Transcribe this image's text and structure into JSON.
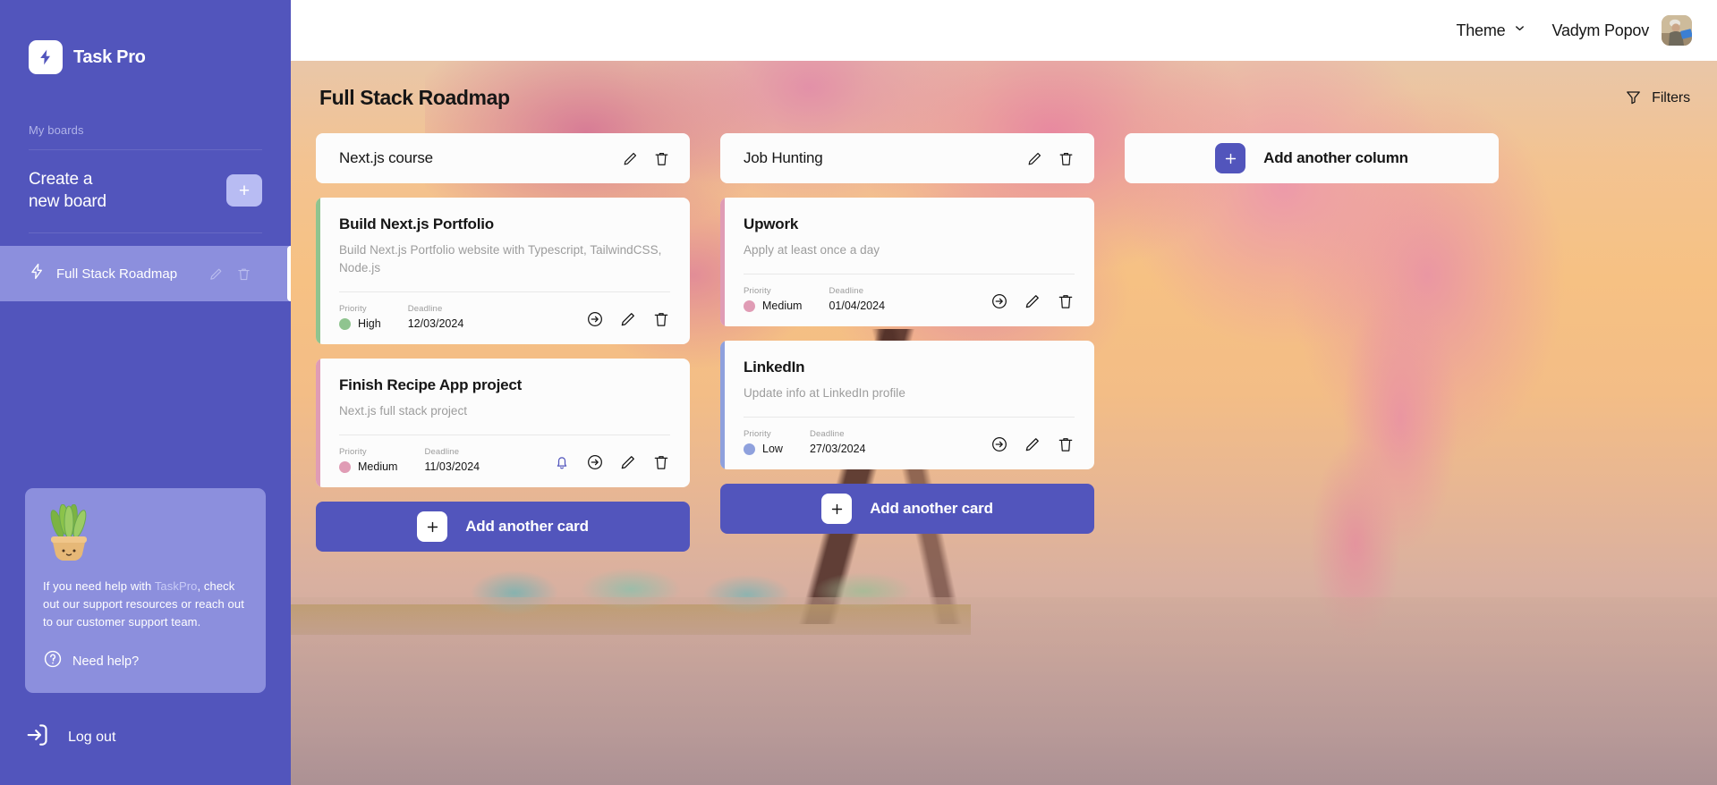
{
  "sidebar": {
    "brand": {
      "name": "Task Pro",
      "logo_icon": "lightning-bolt-icon"
    },
    "my_boards_label": "My boards",
    "create_board": {
      "text": "Create a\nnew board",
      "line1": "Create a",
      "line2": "new board",
      "plus_icon": "plus-icon"
    },
    "boards": [
      {
        "name": "Full Stack Roadmap",
        "icon": "lightning-bolt-icon",
        "active": true,
        "edit_icon": "pencil-icon",
        "delete_icon": "trash-icon"
      }
    ],
    "help": {
      "text_before": "If you need help with ",
      "highlight": "TaskPro",
      "text_after": ", check out our support resources or reach out to our customer support team.",
      "need_help_label": "Need help?",
      "need_help_icon": "question-circle-icon",
      "plant_icon": "potted-plant-icon"
    },
    "logout": {
      "label": "Log out",
      "icon": "logout-arrow-icon"
    }
  },
  "topbar": {
    "theme": {
      "label": "Theme",
      "chevron_icon": "chevron-down-icon"
    },
    "user": {
      "name": "Vadym Popov",
      "avatar_icon": "user-avatar"
    }
  },
  "board": {
    "title": "Full Stack Roadmap",
    "filters": {
      "label": "Filters",
      "icon": "funnel-icon"
    },
    "add_column": {
      "label": "Add another column",
      "plus_icon": "plus-icon"
    },
    "meta_labels": {
      "priority": "Priority",
      "deadline": "Deadline"
    },
    "columns": [
      {
        "title": "Next.js course",
        "edit_icon": "pencil-icon",
        "delete_icon": "trash-icon",
        "add_card_label": "Add another card",
        "cards": [
          {
            "title": "Build Next.js Portfolio",
            "description": "Build Next.js Portfolio website with Typescript, TailwindCSS, Node.js",
            "priority": "High",
            "priority_color": "#8fa texture",
            "deadline": "12/03/2024",
            "has_bell": false,
            "actions": [
              "move-arrow-icon",
              "pencil-icon",
              "trash-icon"
            ]
          },
          {
            "title": "Finish Recipe App project",
            "description": "Next.js full stack project",
            "priority": "Medium",
            "deadline": "11/03/2024",
            "has_bell": true,
            "actions": [
              "bell-icon",
              "move-arrow-icon",
              "pencil-icon",
              "trash-icon"
            ]
          }
        ]
      },
      {
        "title": "Job Hunting",
        "edit_icon": "pencil-icon",
        "delete_icon": "trash-icon",
        "add_card_label": "Add another card",
        "cards": [
          {
            "title": "Upwork",
            "description": "Apply at least once a day",
            "priority": "Medium",
            "deadline": "01/04/2024",
            "has_bell": false,
            "actions": [
              "move-arrow-icon",
              "pencil-icon",
              "trash-icon"
            ]
          },
          {
            "title": "LinkedIn",
            "description": "Update info at LinkedIn profile",
            "priority": "Low",
            "deadline": "27/03/2024",
            "has_bell": false,
            "actions": [
              "move-arrow-icon",
              "pencil-icon",
              "trash-icon"
            ]
          }
        ]
      }
    ]
  },
  "colors": {
    "brand_purple": "#5255bc",
    "sidebar_active": "#8c8fdd",
    "priority_high": "#8fc48f",
    "priority_medium": "#e09cb5",
    "priority_low": "#8fa1dd",
    "bell_purple": "#5255bc",
    "card_bg": "#fcfcfc"
  }
}
